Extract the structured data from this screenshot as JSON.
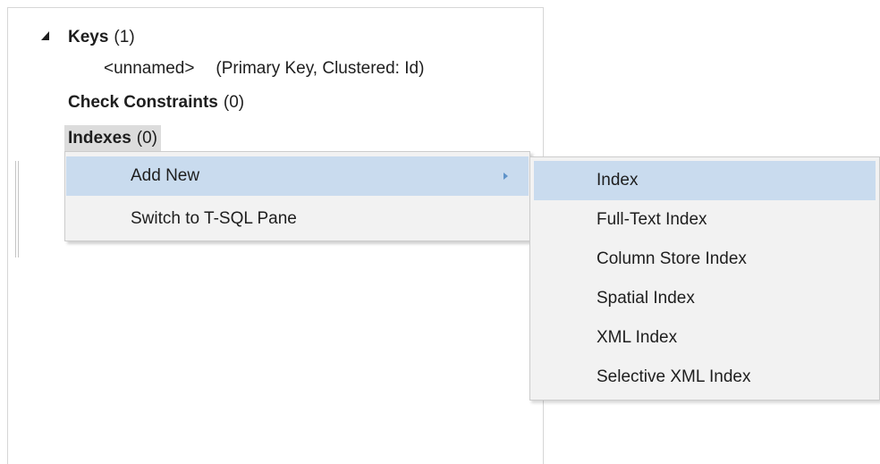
{
  "tree": {
    "keys": {
      "label": "Keys",
      "count": "(1)"
    },
    "unnamed_key": {
      "name": "<unnamed>",
      "detail": "(Primary Key, Clustered: Id)"
    },
    "check_constraints": {
      "label": "Check Constraints",
      "count": "(0)"
    },
    "indexes": {
      "label": "Indexes",
      "count": "(0)"
    }
  },
  "context_menu": {
    "items": [
      {
        "label": "Add New",
        "has_submenu": true,
        "highlighted": true
      },
      {
        "label": "Switch to T-SQL Pane",
        "has_submenu": false,
        "highlighted": false
      }
    ]
  },
  "submenu": {
    "items": [
      {
        "label": "Index",
        "highlighted": true
      },
      {
        "label": "Full-Text Index"
      },
      {
        "label": "Column Store Index"
      },
      {
        "label": "Spatial Index"
      },
      {
        "label": "XML Index"
      },
      {
        "label": "Selective XML Index"
      }
    ]
  },
  "colors": {
    "highlight": "#c9dbee",
    "menu_background": "#f2f2f2",
    "submenu_arrow": "#5f93c9",
    "selection_background": "#dcdcdc"
  }
}
